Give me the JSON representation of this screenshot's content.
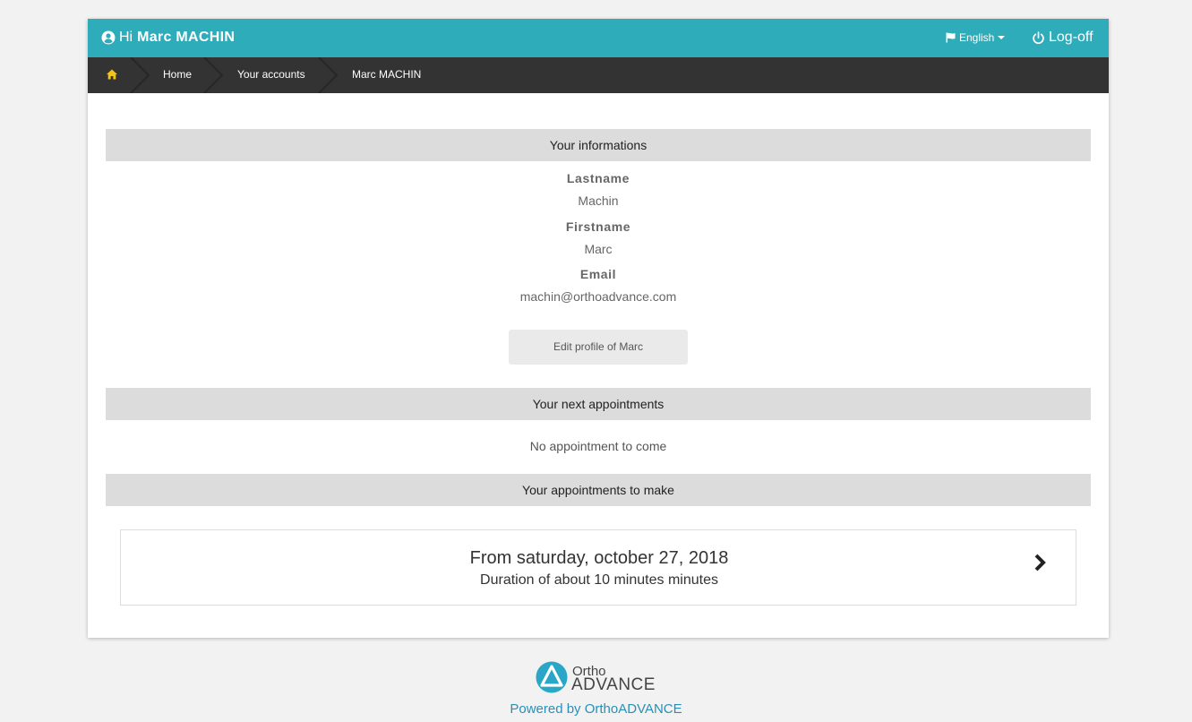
{
  "header": {
    "greeting": "Hi",
    "user_name": "Marc MACHIN",
    "language_label": "English",
    "logoff_label": "Log-off"
  },
  "breadcrumb": {
    "items": [
      "Home",
      "Your accounts",
      "Marc MACHIN"
    ]
  },
  "sections": {
    "informations": {
      "title": "Your informations",
      "lastname_label": "Lastname",
      "lastname_value": "Machin",
      "firstname_label": "Firstname",
      "firstname_value": "Marc",
      "email_label": "Email",
      "email_value": "machin@orthoadvance.com",
      "edit_button": "Edit profile of Marc"
    },
    "next_appointments": {
      "title": "Your next appointments",
      "empty_message": "No appointment to come"
    },
    "appointments_to_make": {
      "title": "Your appointments to make",
      "items": [
        {
          "from": "From saturday, october 27, 2018",
          "duration": "Duration of about 10 minutes minutes"
        }
      ]
    }
  },
  "footer": {
    "logo_line1": "Ortho",
    "logo_line2": "ADVANCE",
    "powered_by": "Powered by OrthoADVANCE"
  },
  "colors": {
    "accent": "#2eacba",
    "breadcrumb_bg": "#333333",
    "section_head_bg": "#dcdcdc",
    "link": "#2a8fb6"
  },
  "icons": {
    "user": "user-circle-icon",
    "language": "flag-icon",
    "logoff": "power-icon",
    "home": "home-icon",
    "next": "chevron-right-icon"
  }
}
